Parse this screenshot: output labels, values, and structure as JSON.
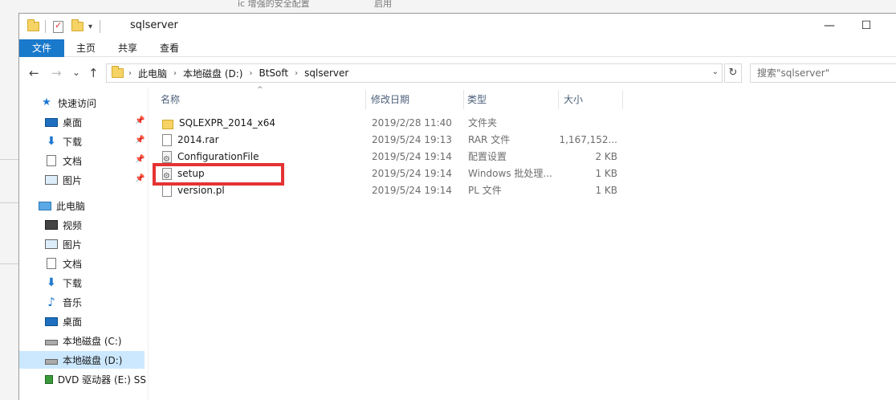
{
  "background": {
    "snippet_left": "ic 增强的安全配置",
    "snippet_right": "启用"
  },
  "title_bar": {
    "title": "sqlserver",
    "minimize": "—",
    "maximize": "☐"
  },
  "ribbon": {
    "tabs": [
      "文件",
      "主页",
      "共享",
      "查看"
    ]
  },
  "address": {
    "back": "←",
    "forward": "→",
    "recent": "⌄",
    "up": "↑",
    "crumbs": [
      "此电脑",
      "本地磁盘 (D:)",
      "BtSoft",
      "sqlserver"
    ],
    "refresh": "↻",
    "search_placeholder": "搜索\"sqlserver\""
  },
  "nav_pane": {
    "quick_access": "快速访问",
    "quick_items": [
      "桌面",
      "下载",
      "文档",
      "图片"
    ],
    "this_pc": "此电脑",
    "pc_items": [
      "视频",
      "图片",
      "文档",
      "下载",
      "音乐",
      "桌面",
      "本地磁盘 (C:)",
      "本地磁盘 (D:)",
      "DVD 驱动器 (E:) SS"
    ]
  },
  "file_list": {
    "columns": [
      "名称",
      "修改日期",
      "类型",
      "大小"
    ],
    "rows": [
      {
        "name": "SQLEXPR_2014_x64",
        "date": "2019/2/28 11:40",
        "type": "文件夹",
        "size": "",
        "icon": "folder-icon"
      },
      {
        "name": "2014.rar",
        "date": "2019/5/24 19:13",
        "type": "RAR 文件",
        "size": "1,167,152...",
        "icon": "archive-icon"
      },
      {
        "name": "ConfigurationFile",
        "date": "2019/5/24 19:14",
        "type": "配置设置",
        "size": "2 KB",
        "icon": "config-icon"
      },
      {
        "name": "setup",
        "date": "2019/5/24 19:14",
        "type": "Windows 批处理...",
        "size": "1 KB",
        "icon": "batch-icon"
      },
      {
        "name": "version.pl",
        "date": "2019/5/24 19:14",
        "type": "PL 文件",
        "size": "1 KB",
        "icon": "file-icon"
      }
    ]
  },
  "colors": {
    "accent": "#1979ca",
    "highlight": "#e53333",
    "selected": "#cce8ff"
  }
}
